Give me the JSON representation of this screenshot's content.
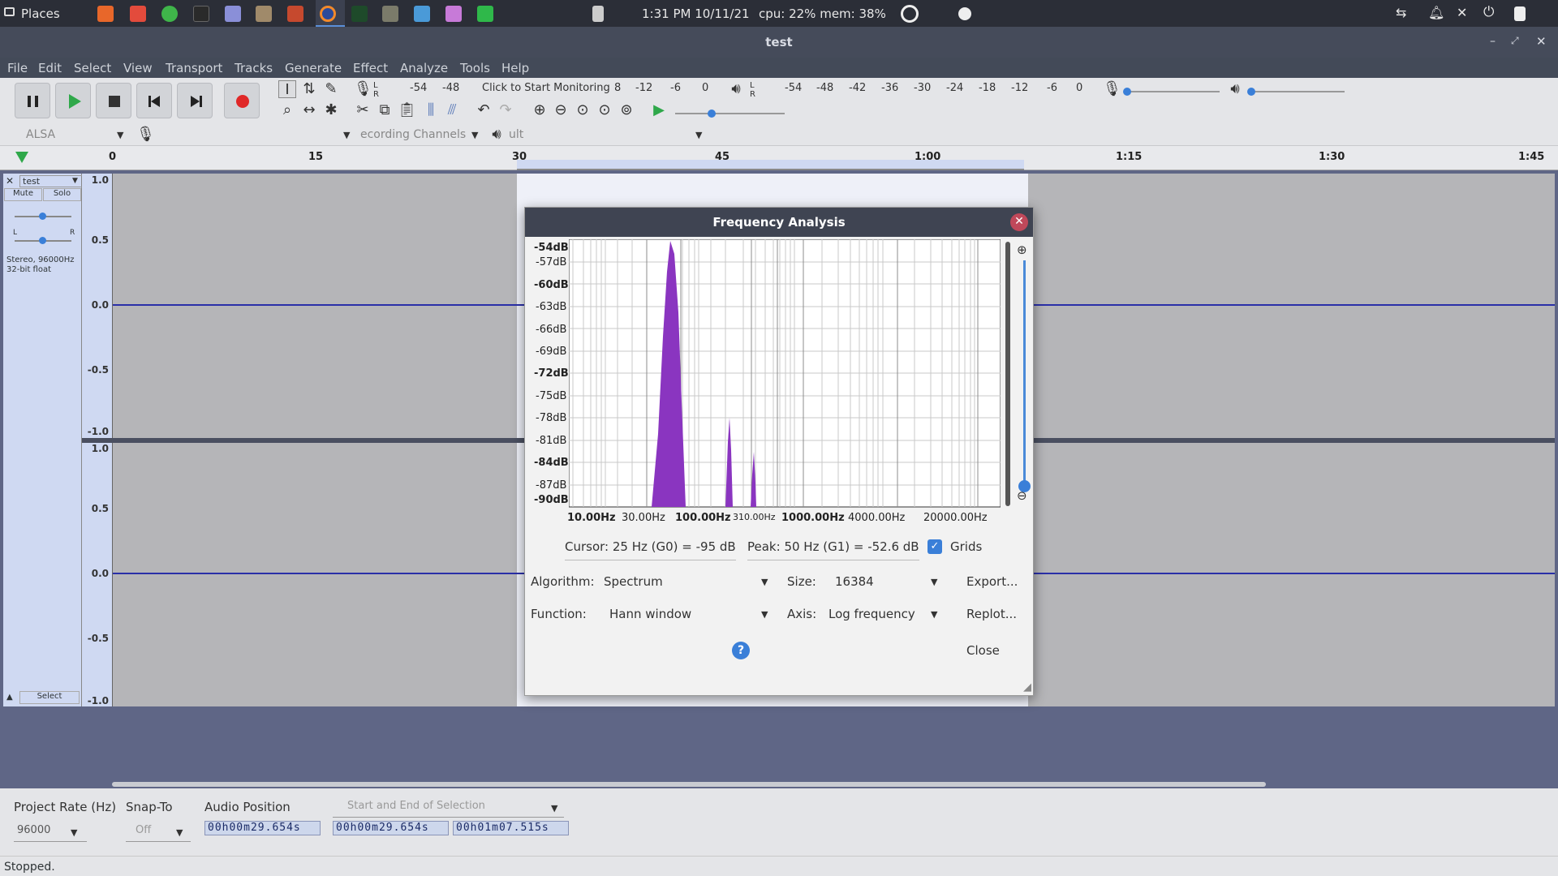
{
  "topbar": {
    "places": "Places",
    "datetime": "1:31 PM  10/11/21",
    "sysinfo": "cpu: 22%  mem: 38%",
    "launcher_icons": [
      "firefox-icon",
      "download-icon",
      "refresh-icon",
      "terminal-icon",
      "notes-icon",
      "archive-icon",
      "settings-icon",
      "audacity-icon",
      "monitor-icon",
      "gimp-icon",
      "image-viewer-icon",
      "files-icon",
      "spreadsheet-icon"
    ]
  },
  "window": {
    "title": "test"
  },
  "menu": [
    "File",
    "Edit",
    "Select",
    "View",
    "Transport",
    "Tracks",
    "Generate",
    "Effect",
    "Analyze",
    "Tools",
    "Help"
  ],
  "toolbar": {
    "record_meter_label": "Click to Start Monitoring",
    "record_scale": [
      "-54",
      "-48",
      "8",
      "-12",
      "-6",
      "0"
    ],
    "play_scale": [
      "-54",
      "-48",
      "-42",
      "-36",
      "-30",
      "-24",
      "-18",
      "-12",
      "-6",
      "0"
    ],
    "host": "ALSA",
    "rec_channels": "ecording Channels",
    "output_device": "ult"
  },
  "ruler": {
    "ticks": [
      "0",
      "15",
      "30",
      "45",
      "1:00",
      "1:15",
      "1:30",
      "1:45"
    ]
  },
  "track": {
    "name": "test",
    "mute": "Mute",
    "solo": "Solo",
    "pan_left": "L",
    "pan_right": "R",
    "format": "Stereo, 96000Hz",
    "bits": "32-bit float",
    "select": "Select",
    "scale": [
      "1.0",
      "0.5",
      "0.0",
      "-0.5",
      "-1.0"
    ]
  },
  "dialog": {
    "title": "Frequency Analysis",
    "db_labels": [
      "-54dB",
      "-57dB",
      "-60dB",
      "-63dB",
      "-66dB",
      "-69dB",
      "-72dB",
      "-75dB",
      "-78dB",
      "-81dB",
      "-84dB",
      "-87dB",
      "-90dB"
    ],
    "freq_labels": [
      "10.00Hz",
      "30.00Hz",
      "100.00Hz",
      "310.00Hz",
      "1000.00Hz",
      "4000.00Hz",
      "20000.00Hz"
    ],
    "cursor": "Cursor: 25 Hz (G0) = -95 dB",
    "peak": "Peak: 50 Hz (G1) = -52.6 dB",
    "grids_label": "Grids",
    "grids_checked": true,
    "algorithm_label": "Algorithm:",
    "algorithm_value": "Spectrum",
    "size_label": "Size:",
    "size_value": "16384",
    "export": "Export...",
    "function_label": "Function:",
    "function_value": "Hann window",
    "axis_label": "Axis:",
    "axis_value": "Log frequency",
    "replot": "Replot...",
    "help": "?",
    "close": "Close",
    "spectrum_color": "#8a35c0"
  },
  "bottom": {
    "project_rate_label": "Project Rate (Hz)",
    "project_rate_value": "96000",
    "snap_label": "Snap-To",
    "snap_value": "Off",
    "audio_position_label": "Audio Position",
    "selection_mode": "Start and End of Selection",
    "audio_position": "00h00m29.654s",
    "sel_start": "00h00m29.654s",
    "sel_end": "00h01m07.515s"
  },
  "status": "Stopped."
}
